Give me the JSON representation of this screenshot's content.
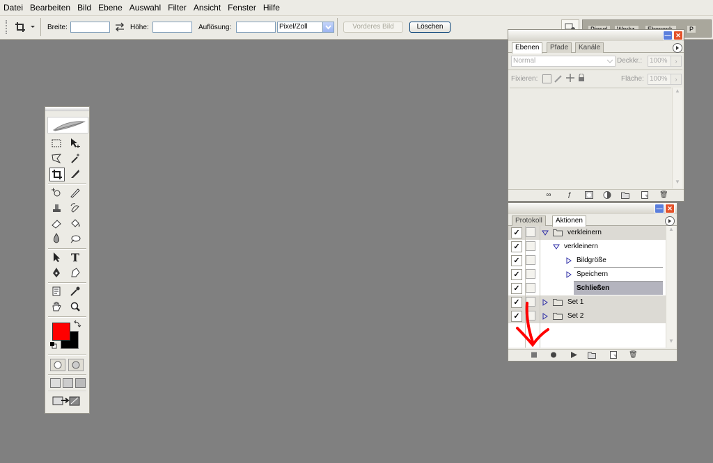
{
  "menu": [
    "Datei",
    "Bearbeiten",
    "Bild",
    "Ebene",
    "Auswahl",
    "Filter",
    "Ansicht",
    "Fenster",
    "Hilfe"
  ],
  "options": {
    "width_label": "Breite:",
    "height_label": "Höhe:",
    "resolution_label": "Auflösung:",
    "unit_value": "Pixel/Zoll",
    "front_image_label": "Vorderes Bild",
    "clear_label": "Löschen",
    "dock_tabs": [
      "Pinsel",
      "Werkz.",
      "Ebenenk.",
      "P"
    ]
  },
  "layers_panel": {
    "tabs": [
      "Ebenen",
      "Pfade",
      "Kanäle"
    ],
    "blend_mode": "Normal",
    "opacity_label": "Deckkr.:",
    "opacity_value": "100%",
    "lock_label": "Fixieren:",
    "fill_label": "Fläche:",
    "fill_value": "100%"
  },
  "actions_panel": {
    "tabs": [
      "Protokoll",
      "Aktionen"
    ],
    "rows": [
      {
        "label": "verkleinern",
        "checked": true,
        "type": "set",
        "expanded": true
      },
      {
        "label": "verkleinern",
        "checked": true,
        "type": "action",
        "expanded": true
      },
      {
        "label": "Bildgröße",
        "checked": true,
        "type": "step"
      },
      {
        "label": "Speichern",
        "checked": true,
        "type": "step"
      },
      {
        "label": "Schließen",
        "checked": true,
        "type": "step",
        "selected": true
      },
      {
        "label": "Set 1",
        "checked": true,
        "type": "set",
        "expanded": false
      },
      {
        "label": "Set 2",
        "checked": true,
        "type": "set",
        "expanded": false
      }
    ],
    "bottom_icons": [
      "stop-icon",
      "record-icon",
      "play-icon",
      "new-set-icon",
      "new-action-icon",
      "trash-icon"
    ]
  },
  "colors": {
    "foreground": "#ff0000",
    "background": "#000000",
    "annotation": "#ff0000"
  }
}
